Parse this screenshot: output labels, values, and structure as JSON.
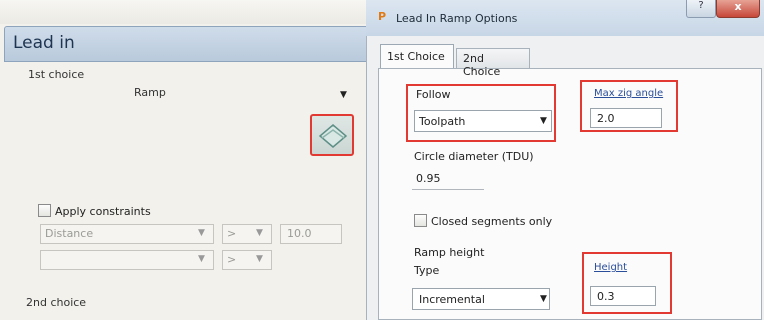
{
  "left_panel": {
    "header": "Lead in",
    "first_choice_label": "1st choice",
    "first_choice_value": "Ramp",
    "ramp_icon": "ramp-diamond-icon",
    "apply_constraints_label": "Apply constraints",
    "constraint_row1": {
      "type": "Distance",
      "operator": ">",
      "value": "10.0"
    },
    "constraint_row2": {
      "type": "",
      "operator": ">"
    },
    "second_choice_label": "2nd choice"
  },
  "dialog": {
    "title": "Lead In Ramp Options",
    "title_icon": "P",
    "help_label": "?",
    "close_label": "x",
    "tabs": [
      {
        "label": "1st Choice"
      },
      {
        "label": "2nd Choice"
      }
    ],
    "follow": {
      "label": "Follow",
      "value": "Toolpath"
    },
    "max_zig_angle": {
      "label": "Max zig angle",
      "value": "2.0"
    },
    "circle_diameter": {
      "label": "Circle diameter (TDU)",
      "value": "0.95"
    },
    "closed_segments_label": "Closed segments only",
    "ramp_height": {
      "section_label": "Ramp height",
      "type_label": "Type",
      "type_value": "Incremental",
      "height_label": "Height",
      "height_value": "0.3"
    }
  },
  "colors": {
    "highlight_red": "#e23a32",
    "header_blue": "#c4d4e6",
    "link_blue": "#2a4e9a"
  }
}
